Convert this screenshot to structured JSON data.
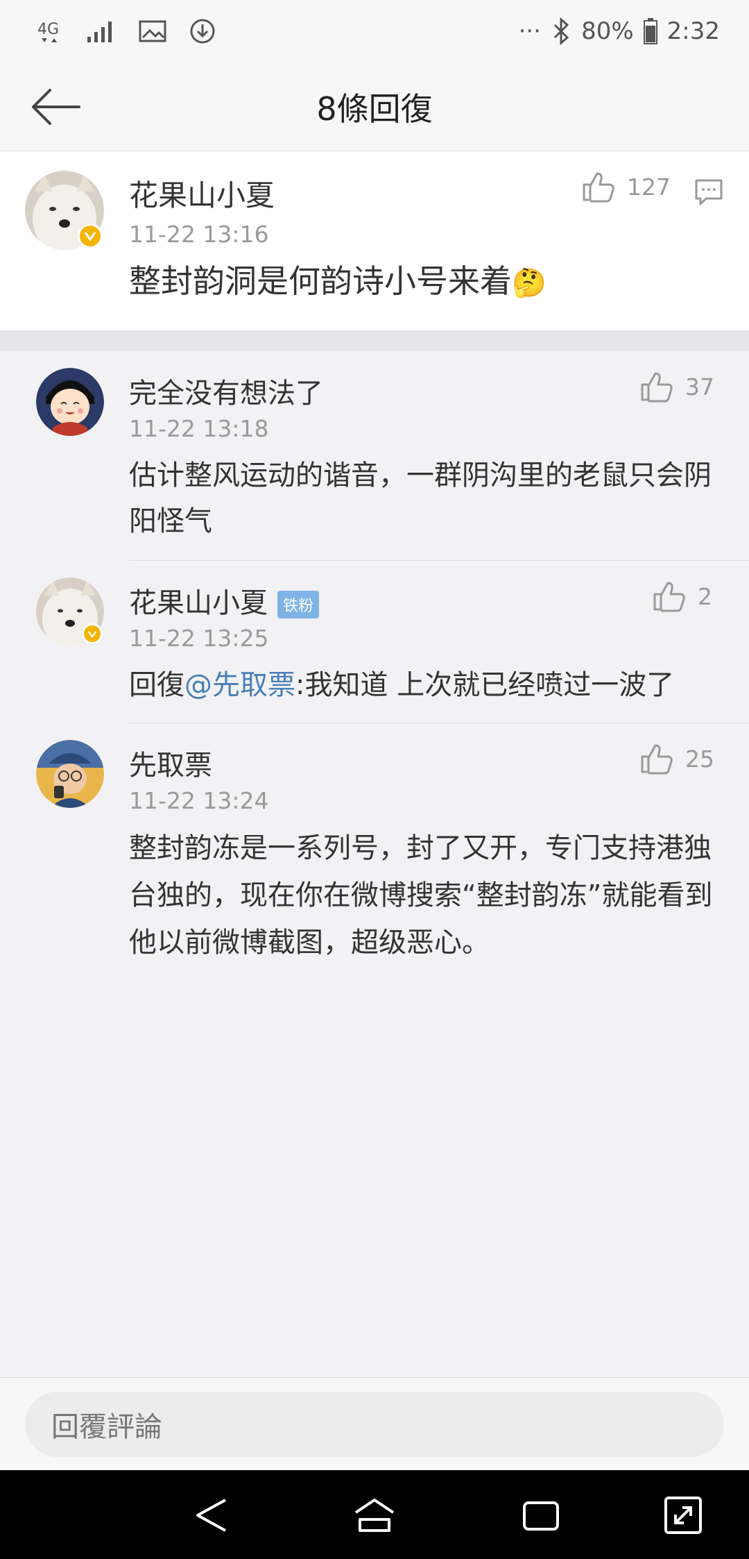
{
  "status_bar": {
    "network": "4G",
    "battery": "80%",
    "time": "2:32",
    "more": "···"
  },
  "header": {
    "title": "8條回復"
  },
  "main_comment": {
    "username": "花果山小夏",
    "time": "11-22 13:16",
    "text": "整封韵洞是何韵诗小号来着",
    "emoji": "🤔",
    "likes": "127"
  },
  "replies": [
    {
      "username": "完全没有想法了",
      "time": "11-22 13:18",
      "text": "估计整风运动的谐音，一群阴沟里的老鼠只会阴阳怪气",
      "likes": "37"
    },
    {
      "username": "花果山小夏",
      "badge": "铁粉",
      "time": "11-22 13:25",
      "text_prefix": "回復",
      "mention": "@先取票",
      "text": ":我知道 上次就已经喷过一波了",
      "likes": "2"
    },
    {
      "username": "先取票",
      "time": "11-22 13:24",
      "text": "整封韵冻是一系列号，封了又开，专门支持港独台独的，现在你在微博搜索“整封韵冻”就能看到他以前微博截图，超级恶心。",
      "likes": "25"
    }
  ],
  "input": {
    "placeholder": "回覆評論"
  },
  "colors": {
    "link": "#4a7fb5",
    "verified_badge": "#f5b400",
    "fan_badge": "#7fb3e6"
  }
}
